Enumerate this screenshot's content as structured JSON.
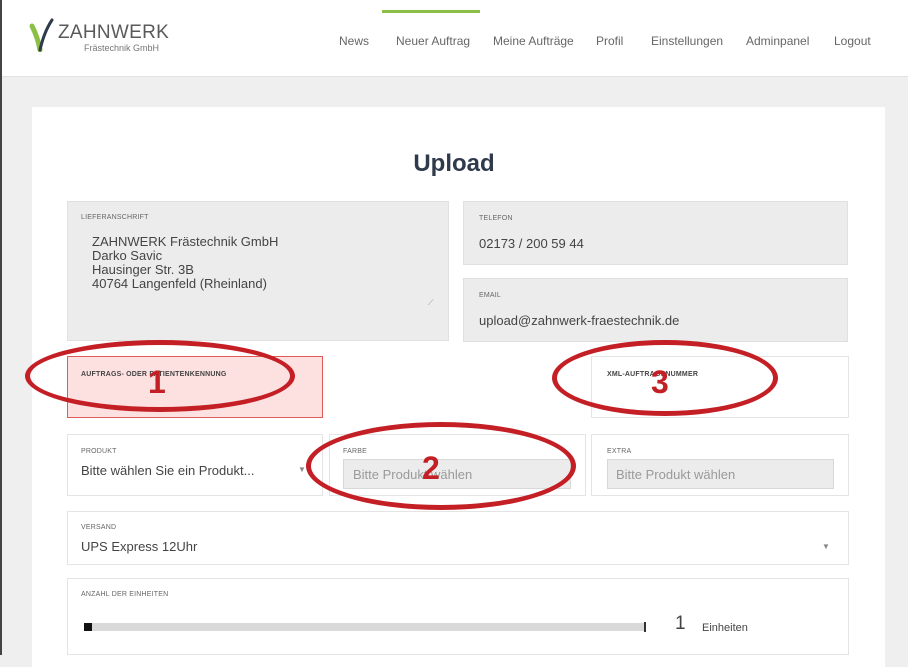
{
  "brand": {
    "title": "ZAHNWERK",
    "subtitle": "Frästechnik GmbH"
  },
  "nav": {
    "items": [
      "News",
      "Neuer Auftrag",
      "Meine Aufträge",
      "Profil",
      "Einstellungen",
      "Adminpanel",
      "Logout"
    ]
  },
  "page": {
    "title": "Upload"
  },
  "address": {
    "label": "Lieferanschrift",
    "lines": [
      "ZAHNWERK Frästechnik GmbH",
      "Darko Savic",
      "Hausinger Str. 3B",
      "40764 Langenfeld (Rheinland)"
    ]
  },
  "phone": {
    "label": "Telefon",
    "value": "02173 / 200 59 44"
  },
  "email": {
    "label": "Email",
    "value": "upload@zahnwerk-fraestechnik.de"
  },
  "order_id": {
    "label": "Auftrags- oder Patientenkennung"
  },
  "xml_order": {
    "label": "XML-Auftragsnummer"
  },
  "product": {
    "label": "Produkt",
    "value": "Bitte wählen Sie ein Produkt..."
  },
  "color": {
    "label": "Farbe",
    "placeholder": "Bitte Produkt wählen"
  },
  "extra": {
    "label": "Extra",
    "placeholder": "Bitte Produkt wählen"
  },
  "shipping": {
    "label": "Versand",
    "value": "UPS Express 12Uhr"
  },
  "units": {
    "label": "Anzahl der Einheiten",
    "value": "1",
    "unit_label": "Einheiten",
    "slider_fraction": 0.0
  },
  "annotations": {
    "one": "1",
    "two": "2",
    "three": "3",
    "color": "#c31f25"
  },
  "colors": {
    "accent": "#8bbf45",
    "error_bg": "#fde1e1",
    "error_border": "#e05b5b"
  }
}
